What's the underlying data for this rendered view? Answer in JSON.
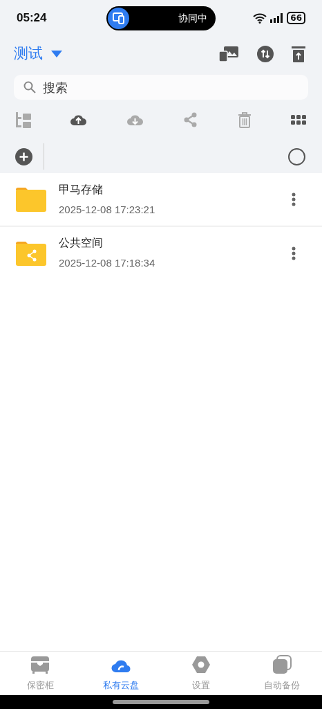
{
  "status_bar": {
    "time": "05:24",
    "activity": "协同中",
    "battery": "66"
  },
  "header": {
    "title": "测试"
  },
  "search": {
    "placeholder": "搜索"
  },
  "toolbar": [
    {
      "kind": "tree",
      "disabled": true
    },
    {
      "kind": "upload",
      "disabled": false
    },
    {
      "kind": "download",
      "disabled": true
    },
    {
      "kind": "share",
      "disabled": true
    },
    {
      "kind": "delete",
      "disabled": true
    },
    {
      "kind": "grid",
      "disabled": false
    }
  ],
  "select_all": {
    "checked": false
  },
  "files": [
    {
      "kind": "folder",
      "name": "甲马存储",
      "date": "2025-12-08 17:23:21"
    },
    {
      "kind": "shared-folder",
      "name": "公共空间",
      "date": "2025-12-08 17:18:34"
    }
  ],
  "tabs": [
    {
      "kind": "vault",
      "label": "保密柜",
      "selected": false
    },
    {
      "kind": "cloud",
      "label": "私有云盘",
      "selected": true
    },
    {
      "kind": "settings",
      "label": "设置",
      "selected": false
    },
    {
      "kind": "backup",
      "label": "自动备份",
      "selected": false
    }
  ]
}
